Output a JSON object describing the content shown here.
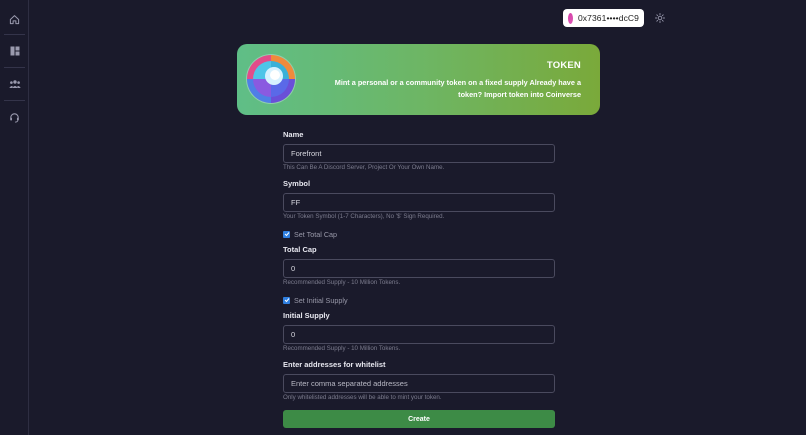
{
  "header": {
    "wallet_address": "0x7361••••dcC9",
    "wallet_dot_color": "#d33fa6"
  },
  "sidebar": {
    "items": [
      {
        "icon": "home-icon"
      },
      {
        "icon": "dashboard-icon"
      },
      {
        "icon": "community-icon"
      },
      {
        "icon": "support-headset-icon"
      }
    ]
  },
  "banner": {
    "title": "TOKEN",
    "description": "Mint a personal or a community token on a fixed supply Already have a token? Import token into Coinverse"
  },
  "form": {
    "name": {
      "label": "Name",
      "value": "Forefront",
      "hint": "This Can Be A Discord Server, Project Or Your Own Name."
    },
    "symbol": {
      "label": "Symbol",
      "value": "FF",
      "hint": "Your Token Symbol (1-7 Characters), No '$' Sign Required."
    },
    "set_total_cap": {
      "label": "Set Total Cap",
      "checked": true
    },
    "total_cap": {
      "label": "Total Cap",
      "value": "0",
      "hint": "Recommended Supply - 10 Million Tokens."
    },
    "set_initial_supply": {
      "label": "Set Initial Supply",
      "checked": true
    },
    "initial_supply": {
      "label": "Initial Supply",
      "value": "0",
      "hint": "Recommended Supply - 10 Million Tokens."
    },
    "whitelist": {
      "label": "Enter addresses for whitelist",
      "placeholder": "Enter comma separated addresses",
      "hint": "Only whitelisted addresses will be able to mint your token."
    },
    "create_label": "Create"
  },
  "colors": {
    "background": "#1a1a2b",
    "accent_green": "#3d8b46",
    "checkbox_blue": "#2f7fe0"
  }
}
